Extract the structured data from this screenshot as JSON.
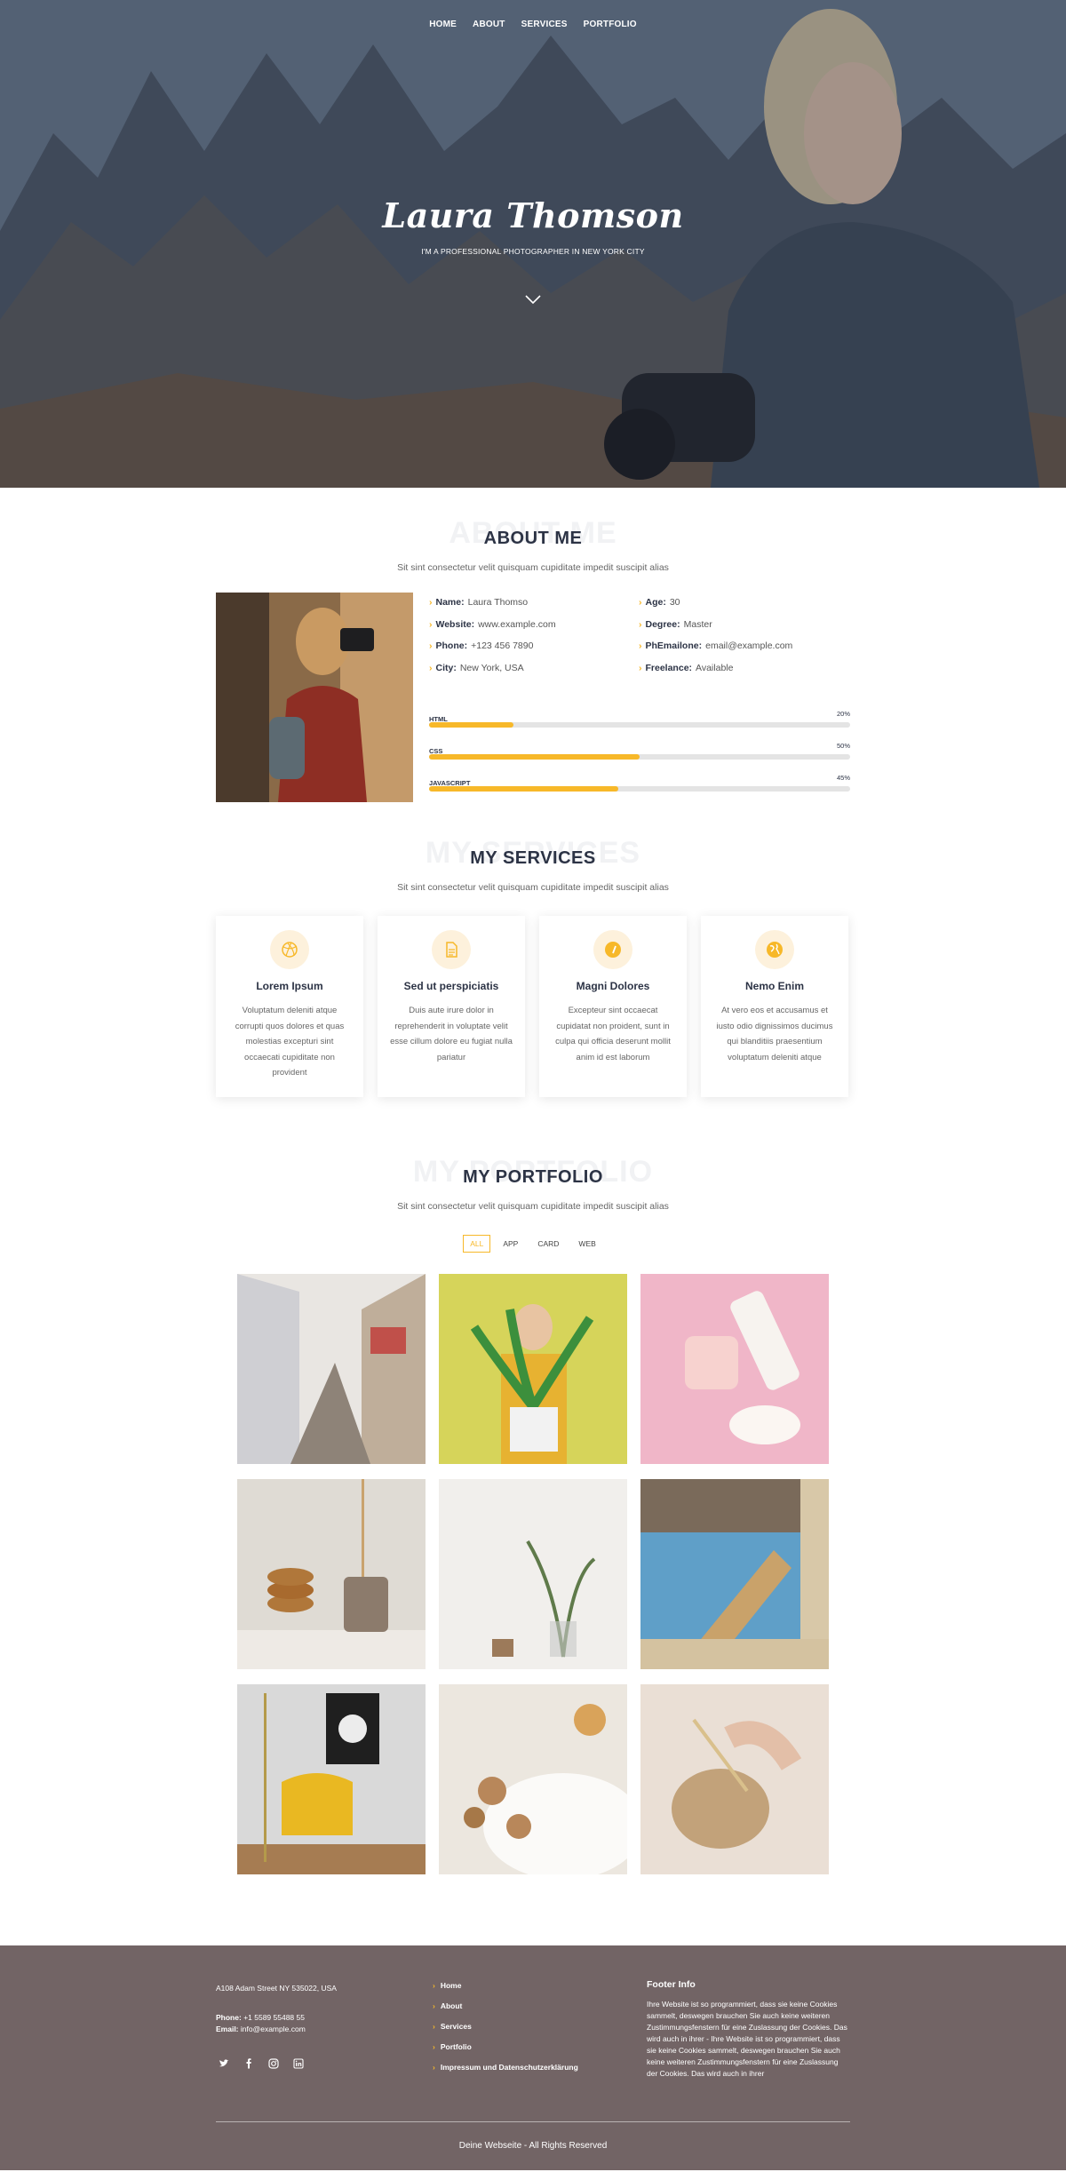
{
  "nav": {
    "items": [
      "HOME",
      "ABOUT",
      "SERVICES",
      "PORTFOLIO"
    ]
  },
  "hero": {
    "title": "Laura Thomson",
    "subtitle": "I'M A PROFESSIONAL PHOTOGRAPHER IN NEW YORK CITY"
  },
  "about": {
    "ghost": "ABOUT ME",
    "title": "ABOUT ME",
    "desc": "Sit sint consectetur velit quisquam cupiditate impedit suscipit alias",
    "left": [
      {
        "label": "Name:",
        "value": "Laura Thomso"
      },
      {
        "label": "Website:",
        "value": "www.example.com"
      },
      {
        "label": "Phone:",
        "value": "+123 456 7890"
      },
      {
        "label": "City:",
        "value": "New York, USA"
      }
    ],
    "right": [
      {
        "label": "Age:",
        "value": "30"
      },
      {
        "label": "Degree:",
        "value": "Master"
      },
      {
        "label": "PhEmailone:",
        "value": "email@example.com"
      },
      {
        "label": "Freelance:",
        "value": "Available"
      }
    ],
    "skills": [
      {
        "name": "HTML",
        "pct": "20%",
        "value": 0.2
      },
      {
        "name": "CSS",
        "pct": "50%",
        "value": 0.5
      },
      {
        "name": "JAVASCRIPT",
        "pct": "45%",
        "value": 0.45
      }
    ]
  },
  "services": {
    "ghost": "MY SERVICES",
    "title": "MY SERVICES",
    "desc": "Sit sint consectetur velit quisquam cupiditate impedit suscipit alias",
    "cards": [
      {
        "icon": "dribbble-icon",
        "title": "Lorem Ipsum",
        "text": "Voluptatum deleniti atque corrupti quos dolores et quas molestias excepturi sint occaecati cupiditate non provident"
      },
      {
        "icon": "file-icon",
        "title": "Sed ut perspiciatis",
        "text": "Duis aute irure dolor in reprehenderit in voluptate velit esse cillum dolore eu fugiat nulla pariatur"
      },
      {
        "icon": "speedometer-icon",
        "title": "Magni Dolores",
        "text": "Excepteur sint occaecat cupidatat non proident, sunt in culpa qui officia deserunt mollit anim id est laborum"
      },
      {
        "icon": "globe-icon",
        "title": "Nemo Enim",
        "text": "At vero eos et accusamus et iusto odio dignissimos ducimus qui blanditiis praesentium voluptatum deleniti atque"
      }
    ]
  },
  "portfolio": {
    "ghost": "MY PORTFOLIO",
    "title": "MY PORTFOLIO",
    "desc": "Sit sint consectetur velit quisquam cupiditate impedit suscipit alias",
    "filters": [
      "ALL",
      "APP",
      "CARD",
      "WEB"
    ],
    "active_filter": "ALL"
  },
  "footer": {
    "address": "A108 Adam Street NY 535022, USA",
    "phone_label": "Phone:",
    "phone": "+1 5589 55488 55",
    "email_label": "Email:",
    "email": "info@example.com",
    "links": [
      "Home",
      "About",
      "Services",
      "Portfolio",
      "Impressum und Datenschutzerklärung"
    ],
    "info_title": "Footer Info",
    "info_text": "Ihre Website ist so programmiert, dass sie keine Cookies sammelt, deswegen brauchen Sie auch keine weiteren Zustimmungsfenstern für eine Zuslassung der Cookies. Das wird auch in ihrer - Ihre Website ist so programmiert, dass sie keine Cookies sammelt, deswegen brauchen Sie auch keine weiteren Zustimmungsfenstern für eine Zuslassung der Cookies. Das wird auch in ihrer",
    "copyright": "Deine Webseite - All Rights Reserved"
  },
  "colors": {
    "accent": "#f7b829",
    "heading": "#2c3345",
    "footer_bg": "#726465"
  }
}
